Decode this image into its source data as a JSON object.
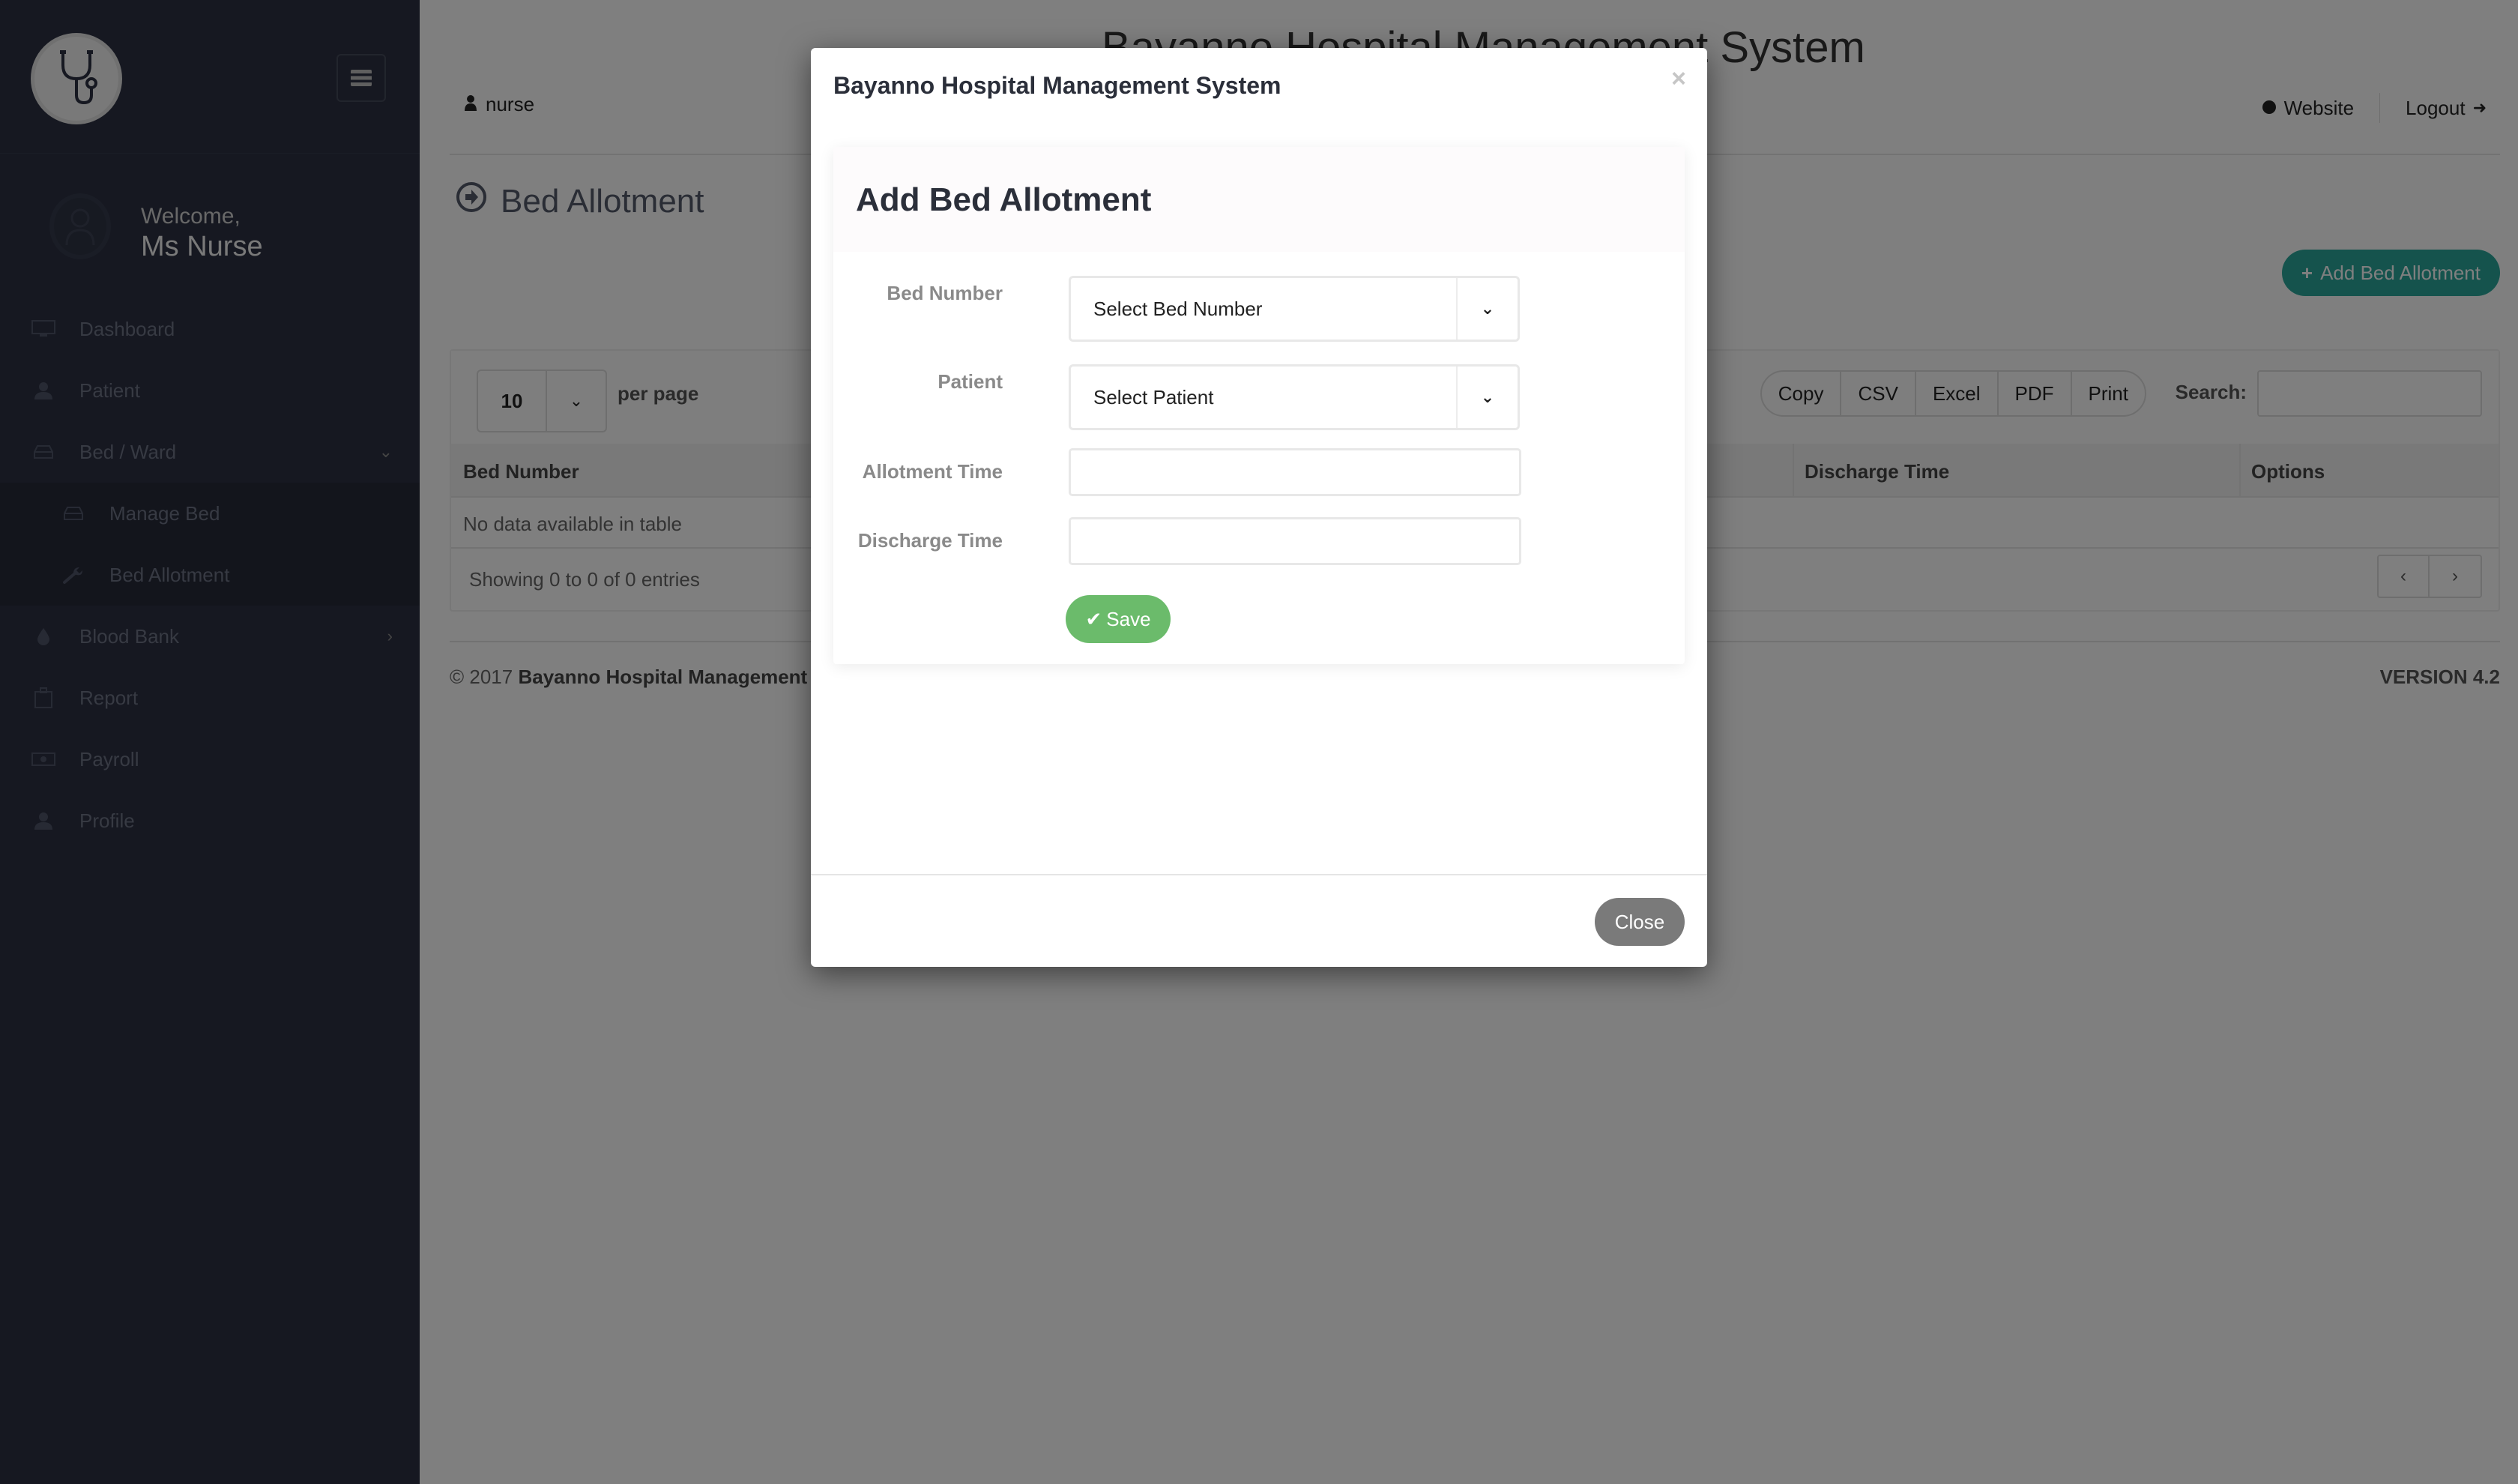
{
  "app": {
    "title": "Bayanno Hospital Management System",
    "user": "nurse",
    "website_label": "Website",
    "logout_label": "Logout"
  },
  "sidebar": {
    "welcome": "Welcome,",
    "user_name": "Ms Nurse",
    "items": [
      {
        "label": "Dashboard",
        "icon": "monitor-icon"
      },
      {
        "label": "Patient",
        "icon": "user-icon"
      },
      {
        "label": "Bed / Ward",
        "icon": "bed-icon",
        "expanded": true
      },
      {
        "label": "Manage Bed",
        "icon": "bed-icon",
        "sub": true
      },
      {
        "label": "Bed Allotment",
        "icon": "wrench-icon",
        "sub": true,
        "active": true
      },
      {
        "label": "Blood Bank",
        "icon": "drop-icon"
      },
      {
        "label": "Report",
        "icon": "hospital-icon"
      },
      {
        "label": "Payroll",
        "icon": "money-icon"
      },
      {
        "label": "Profile",
        "icon": "user-icon"
      }
    ]
  },
  "page": {
    "title": "Bed Allotment",
    "add_button": "Add Bed Allotment"
  },
  "table": {
    "per_page_value": "10",
    "per_page_label": "per page",
    "export_buttons": [
      "Copy",
      "CSV",
      "Excel",
      "PDF",
      "Print"
    ],
    "search_label": "Search:",
    "search_value": "",
    "columns": [
      "Bed Number",
      "Discharge Time",
      "Options"
    ],
    "empty_message": "No data available in table",
    "info": "Showing 0 to 0 of 0 entries",
    "pager_prev": "‹",
    "pager_next": "›"
  },
  "footer": {
    "copyright_prefix": "© 2017 ",
    "copyright_name": "Bayanno Hospital Management S",
    "version": "VERSION 4.2"
  },
  "modal": {
    "title": "Bayanno Hospital Management System",
    "close_x": "×",
    "heading": "Add Bed Allotment",
    "fields": {
      "bed_number_label": "Bed Number",
      "bed_number_value": "Select Bed Number",
      "patient_label": "Patient",
      "patient_value": "Select Patient",
      "allotment_time_label": "Allotment Time",
      "allotment_time_value": "",
      "discharge_time_label": "Discharge Time",
      "discharge_time_value": ""
    },
    "save_label": "Save",
    "close_label": "Close"
  },
  "colors": {
    "sidebar_bg": "#2d3142",
    "accent_teal": "#2aa69a",
    "save_green": "#6bbb6b",
    "close_gray": "#7a7a7a"
  }
}
